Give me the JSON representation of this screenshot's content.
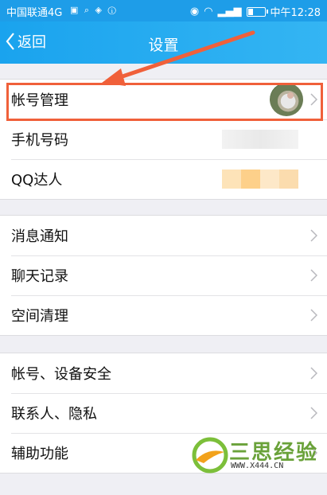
{
  "status_bar": {
    "carrier": "中国联通4G",
    "time": "中午12:28"
  },
  "nav": {
    "back_label": "返回",
    "title": "设置"
  },
  "groups": [
    {
      "items": [
        {
          "label": "帐号管理",
          "value_kind": "avatar"
        },
        {
          "label": "手机号码",
          "value_kind": "blurred"
        },
        {
          "label": "QQ达人",
          "value_kind": "blurred"
        }
      ]
    },
    {
      "items": [
        {
          "label": "消息通知"
        },
        {
          "label": "聊天记录"
        },
        {
          "label": "空间清理"
        }
      ]
    },
    {
      "items": [
        {
          "label": "帐号、设备安全"
        },
        {
          "label": "联系人、隐私"
        },
        {
          "label": "辅助功能"
        }
      ]
    }
  ],
  "annotation": {
    "highlight_color": "#f0603a",
    "arrow_color": "#f0603a"
  },
  "watermark": {
    "brand": "三思经验",
    "url": "WWW.X444.CN"
  },
  "colors": {
    "header": "#1aa3ee",
    "background": "#efeff4"
  }
}
